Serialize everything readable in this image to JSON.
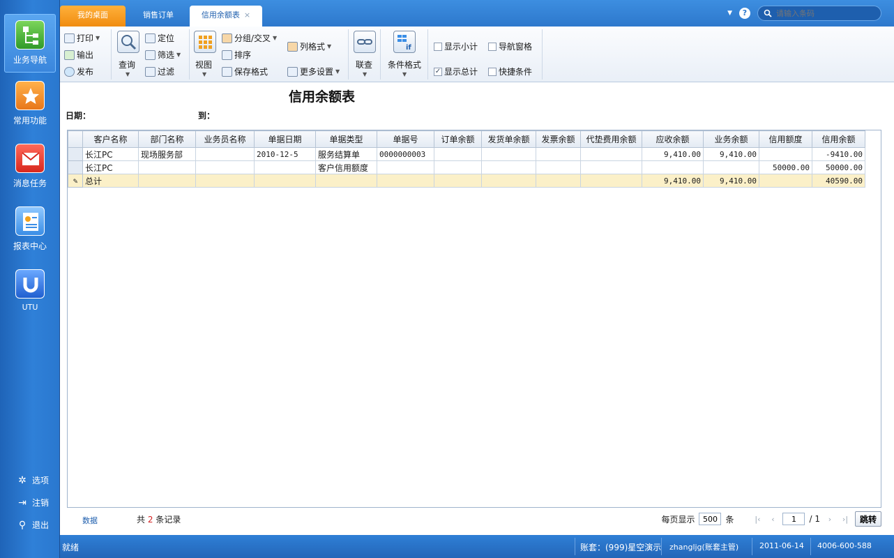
{
  "sidebar": {
    "items": [
      {
        "label": "业务导航",
        "icon": "business-nav-icon"
      },
      {
        "label": "常用功能",
        "icon": "star-icon"
      },
      {
        "label": "消息任务",
        "icon": "mail-icon"
      },
      {
        "label": "报表中心",
        "icon": "report-icon"
      },
      {
        "label": "UTU",
        "icon": "utu-icon"
      }
    ],
    "bottom": [
      {
        "label": "选项",
        "icon": "gear-icon"
      },
      {
        "label": "注销",
        "icon": "logout-icon"
      },
      {
        "label": "退出",
        "icon": "key-icon"
      }
    ]
  },
  "tabs": [
    {
      "label": "我的桌面"
    },
    {
      "label": "销售订单"
    },
    {
      "label": "信用余额表",
      "close": "×"
    }
  ],
  "search": {
    "placeholder": "请输入条码"
  },
  "toolbar": {
    "print": "打印",
    "export": "输出",
    "publish": "发布",
    "query": "查询",
    "locate": "定位",
    "filter": "筛选",
    "filter2": "过滤",
    "view": "视图",
    "group_cross": "分组/交叉",
    "sort": "排序",
    "save_format": "保存格式",
    "column_format": "列格式",
    "more_settings": "更多设置",
    "link_query": "联查",
    "cond_format": "条件格式",
    "show_subtotal": "显示小计",
    "nav_pane": "导航窗格",
    "show_total": "显示总计",
    "quick_cond": "快捷条件",
    "checkmark": "✓"
  },
  "report": {
    "title": "信用余额表",
    "date_label": "日期：",
    "to_label": "到："
  },
  "grid": {
    "headers": [
      "客户名称",
      "部门名称",
      "业务员名称",
      "单据日期",
      "单据类型",
      "单据号",
      "订单余额",
      "发货单余额",
      "发票余额",
      "代垫费用余额",
      "应收余额",
      "业务余额",
      "信用额度",
      "信用余额"
    ],
    "rows": [
      [
        "长江PC",
        "现场服务部",
        "",
        "2010-12-5",
        "服务结算单",
        "0000000003",
        "",
        "",
        "",
        "",
        "9,410.00",
        "9,410.00",
        "",
        "-9410.00"
      ],
      [
        "长江PC",
        "",
        "",
        "",
        "客户信用额度",
        "",
        "",
        "",
        "",
        "",
        "",
        "",
        "50000.00",
        "50000.00"
      ]
    ],
    "total": [
      "总计",
      "",
      "",
      "",
      "",
      "",
      "",
      "",
      "",
      "",
      "9,410.00",
      "9,410.00",
      "",
      "40590.00"
    ],
    "edit_icon": "✎"
  },
  "pager": {
    "data_tab": "数据",
    "count_prefix": "共",
    "count": "2",
    "count_suffix": "条记录",
    "per_page_label": "每页显示",
    "per_page": "500",
    "per_page_unit": "条",
    "page": "1",
    "total_pages": "/ 1",
    "jump": "跳转"
  },
  "status": {
    "ready": "就绪",
    "account": "账套：(999)星空演示",
    "user": "zhangljg(账套主管)",
    "date": "2011-06-14",
    "phone": "4006-600-588"
  },
  "colors": {
    "sidebar": "#2f80d8",
    "home_tab": "#f08c10",
    "total_row": "#fbf0c8",
    "accent": "#1f5fae"
  }
}
